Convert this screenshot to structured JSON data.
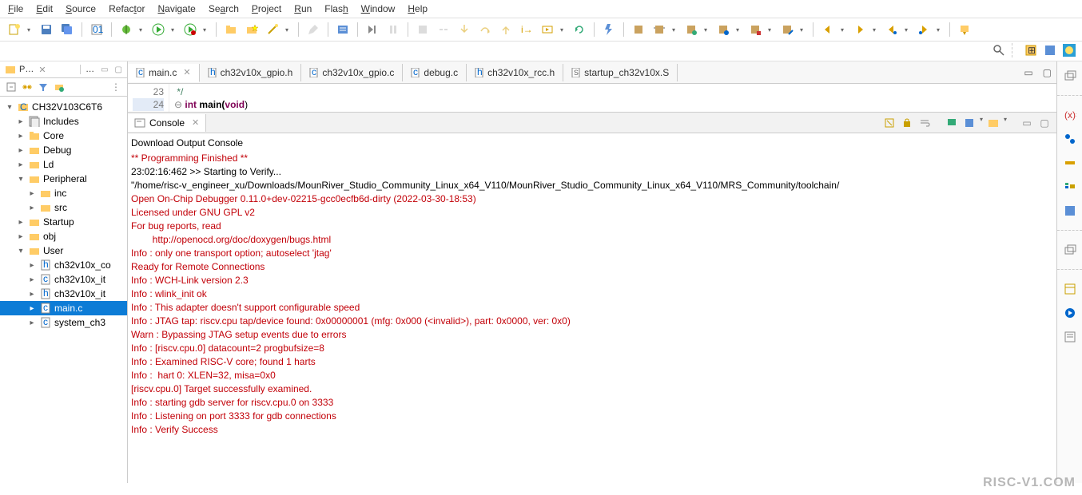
{
  "menu": [
    "File",
    "Edit",
    "Source",
    "Refactor",
    "Navigate",
    "Search",
    "Project",
    "Run",
    "Flash",
    "Window",
    "Help"
  ],
  "tree": {
    "project": "CH32V103C6T6",
    "includes": "Includes",
    "core": "Core",
    "debug": "Debug",
    "ld": "Ld",
    "peripheral": "Peripheral",
    "inc": "inc",
    "src": "src",
    "startup": "Startup",
    "obj": "obj",
    "user": "User",
    "u_conf": "ch32v10x_co",
    "u_it1": "ch32v10x_it",
    "u_it2": "ch32v10x_it",
    "u_main": "main.c",
    "u_sys": "system_ch3"
  },
  "pe_tab": "P…",
  "pe_sec": "…",
  "editor_tabs": {
    "main": "main.c",
    "gpio_h": "ch32v10x_gpio.h",
    "gpio_c": "ch32v10x_gpio.c",
    "debug_c": "debug.c",
    "rcc_h": "ch32v10x_rcc.h",
    "startup_s": "startup_ch32v10x.S"
  },
  "editor": {
    "ln23": "23",
    "ln24": "24",
    "cmt_end": " */",
    "code24": "int main(void)",
    "kw_int": "int",
    "fn_main": " main(",
    "kw_void": "void",
    "paren_close": ")"
  },
  "console": {
    "tab": "Console",
    "title": "Download Output Console",
    "l1": "** Programming Finished **",
    "l2": "",
    "l3": "23:02:16:462 >> Starting to Verify...",
    "l4": "\"/home/risc-v_engineer_xu/Downloads/MounRiver_Studio_Community_Linux_x64_V110/MounRiver_Studio_Community_Linux_x64_V110/MRS_Community/toolchain/",
    "l5": "Open On-Chip Debugger 0.11.0+dev-02215-gcc0ecfb6d-dirty (2022-03-30-18:53)",
    "l6": "Licensed under GNU GPL v2",
    "l7": "For bug reports, read",
    "l8": "        http://openocd.org/doc/doxygen/bugs.html",
    "l9": "Info : only one transport option; autoselect 'jtag'",
    "l10": "Ready for Remote Connections",
    "l11": "Info : WCH-Link version 2.3",
    "l12": "Info : wlink_init ok",
    "l13": "Info : This adapter doesn't support configurable speed",
    "l14": "Info : JTAG tap: riscv.cpu tap/device found: 0x00000001 (mfg: 0x000 (<invalid>), part: 0x0000, ver: 0x0)",
    "l15": "Warn : Bypassing JTAG setup events due to errors",
    "l16": "Info : [riscv.cpu.0] datacount=2 progbufsize=8",
    "l17": "Info : Examined RISC-V core; found 1 harts",
    "l18": "Info :  hart 0: XLEN=32, misa=0x0",
    "l19": "[riscv.cpu.0] Target successfully examined.",
    "l20": "Info : starting gdb server for riscv.cpu.0 on 3333",
    "l21": "Info : Listening on port 3333 for gdb connections",
    "l22": "Info : Verify Success"
  },
  "watermark": "RISC-V1.COM"
}
